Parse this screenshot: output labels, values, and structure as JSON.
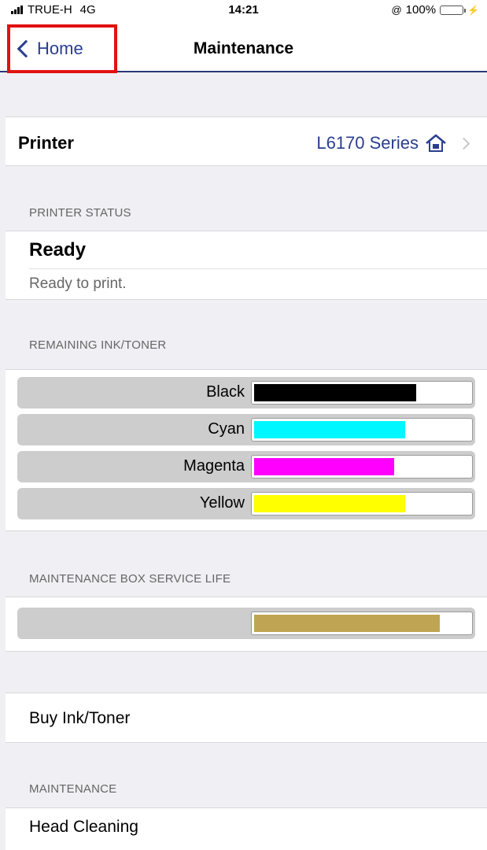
{
  "status_bar": {
    "carrier": "TRUE-H",
    "network": "4G",
    "time": "14:21",
    "battery_percent": "100%"
  },
  "nav": {
    "back_label": "Home",
    "title": "Maintenance"
  },
  "printer": {
    "label": "Printer",
    "value": "L6170 Series"
  },
  "printer_status": {
    "header": "PRINTER STATUS",
    "title": "Ready",
    "description": "Ready to print."
  },
  "ink": {
    "header": "REMAINING INK/TONER",
    "items": [
      {
        "name": "Black",
        "color": "#000000",
        "level": 0.75
      },
      {
        "name": "Cyan",
        "color": "#00f7ff",
        "level": 0.7
      },
      {
        "name": "Magenta",
        "color": "#ff00ff",
        "level": 0.65
      },
      {
        "name": "Yellow",
        "color": "#ffff00",
        "level": 0.7
      }
    ]
  },
  "maintenance_box": {
    "header": "MAINTENANCE BOX SERVICE LIFE",
    "color": "#bfa553",
    "level": 0.86
  },
  "buy": {
    "label": "Buy Ink/Toner"
  },
  "maintenance": {
    "header": "MAINTENANCE",
    "items": [
      "Head Cleaning"
    ]
  },
  "colors": {
    "accent": "#2a3e8f",
    "highlight_box": "#e11111"
  }
}
